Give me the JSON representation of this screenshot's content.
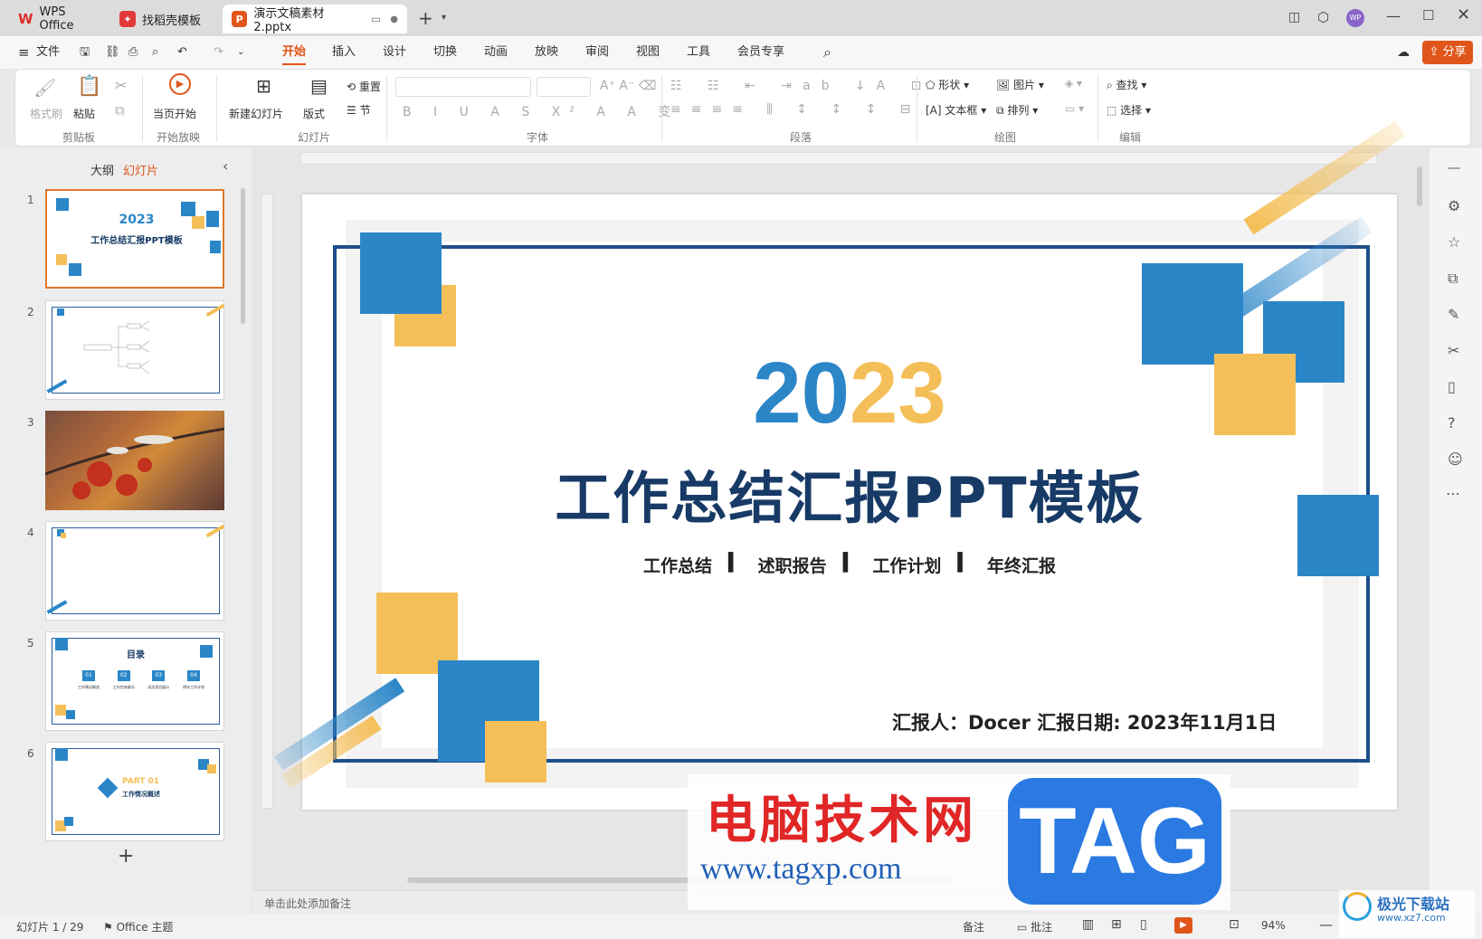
{
  "tabs": {
    "wps": "WPS Office",
    "template": "找稻壳模板",
    "doc": "演示文稿素材2.pptx"
  },
  "menu": {
    "file": "文件",
    "items": [
      "开始",
      "插入",
      "设计",
      "切换",
      "动画",
      "放映",
      "审阅",
      "视图",
      "工具",
      "会员专享"
    ],
    "share": "分享"
  },
  "ribbon": {
    "format_brush": "格式刷",
    "paste": "粘贴",
    "clipboard": "剪贴板",
    "play_current": "当页开始",
    "start_show": "开始放映",
    "new_slide": "新建幻灯片",
    "layout": "版式",
    "reset": "重置",
    "section": "节",
    "slides_group": "幻灯片",
    "font_group": "字体",
    "para_group": "段落",
    "shape": "形状",
    "picture": "图片",
    "textbox": "文本框",
    "arrange": "排列",
    "draw_group": "绘图",
    "find": "查找",
    "select": "选择",
    "edit_group": "编辑"
  },
  "panel": {
    "outline": "大纲",
    "slides": "幻灯片",
    "add_icon": "+"
  },
  "thumbs": [
    {
      "num": "1",
      "title": "2023",
      "subtitle": "工作总结汇报PPT模板"
    },
    {
      "num": "2"
    },
    {
      "num": "3"
    },
    {
      "num": "4"
    },
    {
      "num": "5",
      "title": "目录",
      "items": [
        "工作情况概述",
        "工作完成情况",
        "成功项目展示",
        "明年工作计划"
      ]
    },
    {
      "num": "6",
      "title": "PART 01",
      "subtitle": "工作情况概述"
    }
  ],
  "slide": {
    "year_a": "20",
    "year_b": "23",
    "title": "工作总结汇报PPT模板",
    "tags": [
      "工作总结",
      "述职报告",
      "工作计划",
      "年终汇报"
    ],
    "reporter": "汇报人：Docer  汇报日期: 2023年11月1日"
  },
  "notes_placeholder": "单击此处添加备注",
  "status": {
    "slide_count": "幻灯片 1 / 29",
    "theme": "Office 主题",
    "notes": "备注",
    "comments": "批注",
    "zoom": "94%"
  },
  "watermark": {
    "site_cn": "电脑技术网",
    "site_url": "www.tagxp.com",
    "tag": "TAG",
    "corner": "极光下载站",
    "corner_url": "www.xz7.com"
  },
  "colors": {
    "accent": "#e0561a",
    "blue": "#2b86c8",
    "gold": "#f4bf58",
    "navy": "#173a66"
  }
}
